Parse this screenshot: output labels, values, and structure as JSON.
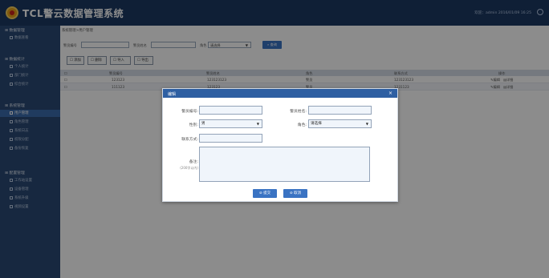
{
  "header": {
    "app_title": "TCL警云数据管理系统",
    "user_info": "欢迎：admin 2016/01/09 16:25"
  },
  "sidebar": {
    "groups": [
      {
        "title": "数据管理",
        "items": [
          "数据查看"
        ]
      },
      {
        "title": "数据统计",
        "items": [
          "个人统计",
          "部门统计",
          "综合统计"
        ]
      },
      {
        "title": "系统管理",
        "items": [
          "用户管理",
          "角色管理",
          "系统日志",
          "权限分配",
          "备份恢复"
        ]
      },
      {
        "title": "配置管理",
        "items": [
          "工作站设置",
          "设备管理",
          "系统升级",
          "视频设置"
        ]
      }
    ]
  },
  "main": {
    "breadcrumb": "系统管理>用户管理",
    "search": {
      "id_label": "警员编号",
      "name_label": "警员姓名",
      "role_label": "角色",
      "role_value": "请选择",
      "query_label": "查询"
    },
    "toolbar": [
      "添加",
      "删除",
      "导入",
      "导出"
    ],
    "table": {
      "columns": [
        "警员编号",
        "警员姓名",
        "角色",
        "联系方式",
        "操作"
      ],
      "rows": [
        [
          "123123",
          "123123123",
          "警员",
          "123123123",
          "编辑",
          "详细"
        ],
        [
          "111123",
          "123123",
          "警员",
          "1231123",
          "编辑",
          "详细"
        ]
      ]
    }
  },
  "modal": {
    "title": "编辑",
    "close": "×",
    "fields": {
      "officer_id_label": "警员编号:",
      "officer_name_label": "警员姓名:",
      "gender_label": "性别:",
      "gender_value": "男",
      "role_label": "角色:",
      "role_value": "请选择",
      "contact_label": "联系方式:",
      "remark_label": "备注:",
      "remark_note": "(200字以内)"
    },
    "buttons": {
      "submit": "提交",
      "cancel": "取消"
    }
  },
  "colors": {
    "header_bg": "#1d3a63",
    "sidebar_bg": "#2b4a75",
    "accent": "#3a73c3",
    "modal_head": "#2e5fa2"
  }
}
